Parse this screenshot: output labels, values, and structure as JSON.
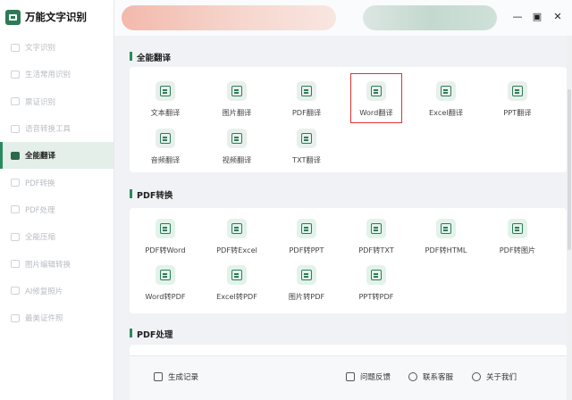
{
  "app": {
    "title": "万能文字识别"
  },
  "window": {
    "minimize": "—",
    "maximize": "▣",
    "close": "✕"
  },
  "sidebar": {
    "items": [
      {
        "label": "文字识别",
        "active": false
      },
      {
        "label": "生活常用识别",
        "active": false
      },
      {
        "label": "票证识别",
        "active": false
      },
      {
        "label": "语音转换工具",
        "active": false
      },
      {
        "label": "全能翻译",
        "active": true
      },
      {
        "label": "PDF转换",
        "active": false
      },
      {
        "label": "PDF处理",
        "active": false
      },
      {
        "label": "全能压缩",
        "active": false
      },
      {
        "label": "图片编辑转换",
        "active": false
      },
      {
        "label": "AI修复照片",
        "active": false
      },
      {
        "label": "最美证件照",
        "active": false
      }
    ]
  },
  "sections": {
    "translate": {
      "title": "全能翻译",
      "tiles": [
        {
          "label": "文本翻译",
          "icon": "document-translate-icon"
        },
        {
          "label": "图片翻译",
          "icon": "image-translate-icon"
        },
        {
          "label": "PDF翻译",
          "icon": "pdf-translate-icon"
        },
        {
          "label": "Word翻译",
          "icon": "word-translate-icon",
          "highlighted": true
        },
        {
          "label": "Excel翻译",
          "icon": "excel-translate-icon"
        },
        {
          "label": "PPT翻译",
          "icon": "ppt-translate-icon"
        },
        {
          "label": "音频翻译",
          "icon": "audio-translate-icon"
        },
        {
          "label": "视频翻译",
          "icon": "video-translate-icon"
        },
        {
          "label": "TXT翻译",
          "icon": "txt-translate-icon"
        }
      ]
    },
    "pdf_convert": {
      "title": "PDF转换",
      "tiles": [
        {
          "label": "PDF转Word",
          "icon": "pdf-to-word-icon"
        },
        {
          "label": "PDF转Excel",
          "icon": "pdf-to-excel-icon"
        },
        {
          "label": "PDF转PPT",
          "icon": "pdf-to-ppt-icon"
        },
        {
          "label": "PDF转TXT",
          "icon": "pdf-to-txt-icon"
        },
        {
          "label": "PDF转HTML",
          "icon": "pdf-to-html-icon"
        },
        {
          "label": "PDF转图片",
          "icon": "pdf-to-image-icon"
        },
        {
          "label": "Word转PDF",
          "icon": "word-to-pdf-icon"
        },
        {
          "label": "Excel转PDF",
          "icon": "excel-to-pdf-icon"
        },
        {
          "label": "图片转PDF",
          "icon": "image-to-pdf-icon"
        },
        {
          "label": "PPT转PDF",
          "icon": "ppt-to-pdf-icon"
        }
      ]
    },
    "pdf_process": {
      "title": "PDF处理"
    }
  },
  "bottom": {
    "history": "生成记录",
    "feedback": "问题反馈",
    "support": "联系客服",
    "about": "关于我们"
  },
  "colors": {
    "accent": "#2b8a5d",
    "highlight": "#e03131"
  }
}
